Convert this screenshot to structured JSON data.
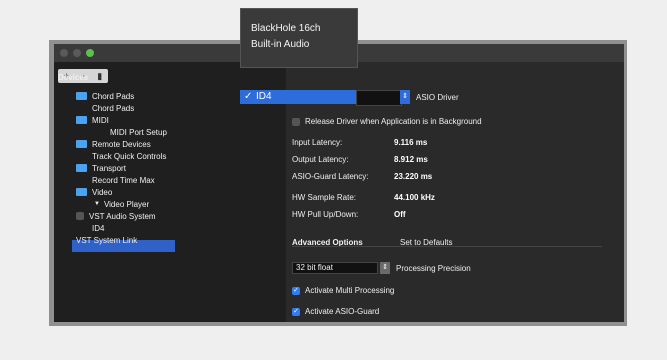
{
  "sidebar": {
    "title": "Devices",
    "items": [
      {
        "label": "Chord Pads",
        "folder": true
      },
      {
        "label": "Chord Pads",
        "folder": false
      },
      {
        "label": "MIDI",
        "folder": true
      },
      {
        "label": "MIDI Port Setup",
        "folder": false
      },
      {
        "label": "Remote Devices",
        "folder": true
      },
      {
        "label": "Track Quick Controls",
        "folder": false
      },
      {
        "label": "Transport",
        "folder": true
      },
      {
        "label": "Record Time Max",
        "folder": false
      },
      {
        "label": "Video",
        "folder": true
      },
      {
        "label": "Video Player",
        "folder": false
      },
      {
        "label": "VST Audio System",
        "folder": false
      },
      {
        "label": "ID4",
        "folder": false
      },
      {
        "label": "VST System Link",
        "folder": false
      }
    ]
  },
  "driver_menu": {
    "options": [
      "BlackHole 16ch",
      "Built-in Audio",
      "ID4"
    ],
    "selected": "ID4",
    "checkmark": "✓"
  },
  "asio_driver_label": "ASIO Driver",
  "release_driver_label": "Release Driver when Application is in Background",
  "stats": [
    {
      "label": "Input Latency:",
      "value": "9.116 ms"
    },
    {
      "label": "Output Latency:",
      "value": "8.912 ms"
    },
    {
      "label": "ASIO-Guard Latency:",
      "value": "23.220 ms"
    },
    {
      "label": "HW Sample Rate:",
      "value": "44.100 kHz"
    },
    {
      "label": "HW Pull Up/Down:",
      "value": "Off"
    }
  ],
  "advanced": {
    "title": "Advanced Options",
    "defaults_link": "Set to Defaults"
  },
  "precision": {
    "value": "32 bit float",
    "label": "Processing Precision"
  },
  "checkboxes": [
    {
      "label": "Activate Multi Processing",
      "checked": true
    },
    {
      "label": "Activate ASIO-Guard",
      "checked": true
    }
  ]
}
